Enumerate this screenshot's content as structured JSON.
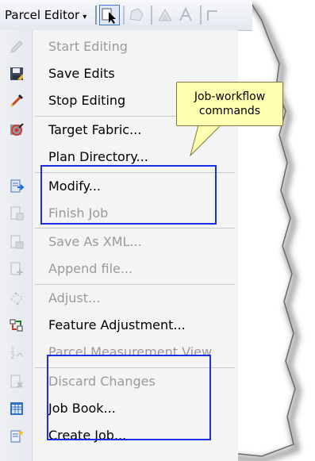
{
  "toolbar": {
    "title": "Parcel Editor",
    "caret": "▾"
  },
  "callout": {
    "line1": "Job-workflow",
    "line2": "commands"
  },
  "menu": {
    "items": [
      {
        "label": "Start Editing",
        "disabled": true,
        "icon": "start-editing-icon"
      },
      {
        "label": "Save Edits",
        "disabled": false,
        "icon": "save-edits-icon"
      },
      {
        "label": "Stop Editing",
        "disabled": false,
        "icon": "stop-editing-icon"
      },
      {
        "label": "Target Fabric...",
        "disabled": false,
        "icon": "target-fabric-icon"
      },
      {
        "label": "Plan Directory...",
        "disabled": false,
        "icon": ""
      },
      {
        "label": "Modify...",
        "disabled": false,
        "icon": "modify-icon"
      },
      {
        "label": "Finish Job",
        "disabled": true,
        "icon": "finish-job-icon"
      },
      {
        "label": "Save As XML...",
        "disabled": true,
        "icon": "save-as-xml-icon"
      },
      {
        "label": "Append file...",
        "disabled": true,
        "icon": "append-file-icon"
      },
      {
        "label": "Adjust...",
        "disabled": true,
        "icon": "adjust-icon"
      },
      {
        "label": "Feature Adjustment...",
        "disabled": false,
        "icon": "feature-adjustment-icon"
      },
      {
        "label": "Parcel Measurement View",
        "disabled": true,
        "icon": "parcel-measurement-icon"
      },
      {
        "label": "Discard Changes",
        "disabled": true,
        "icon": "discard-changes-icon"
      },
      {
        "label": "Job Book...",
        "disabled": false,
        "icon": "job-book-icon"
      },
      {
        "label": "Create Job...",
        "disabled": false,
        "icon": "create-job-icon"
      }
    ]
  }
}
